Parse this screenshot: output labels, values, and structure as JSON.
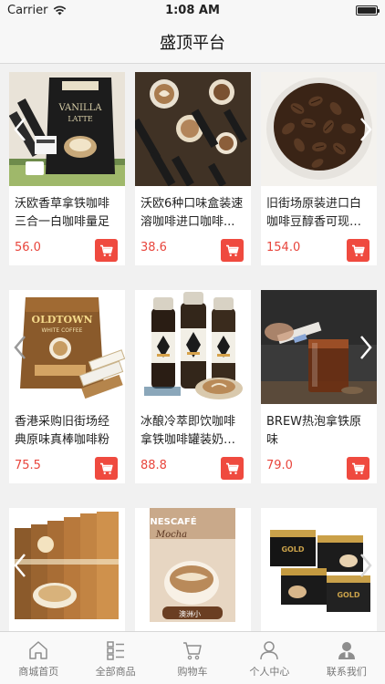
{
  "status_bar": {
    "carrier": "Carrier",
    "time": "1:08 AM",
    "battery_level": 1.0
  },
  "nav": {
    "title": "盛顶平台"
  },
  "products": [
    {
      "name": "沃欧香草拿铁咖啡三合一白咖啡量足",
      "price": "56.0",
      "image": "vanilla-latte-packaging",
      "arrows": [
        "left"
      ]
    },
    {
      "name": "沃欧6种口味盒装速溶咖啡进口咖啡...",
      "price": "38.6",
      "image": "coffee-cups-and-sticks",
      "arrows": []
    },
    {
      "name": "旧街场原装进口白咖啡豆醇香可现磨...",
      "price": "154.0",
      "image": "coffee-beans-bowl",
      "arrows": [
        "right"
      ]
    },
    {
      "name": "香港采购旧街场经典原味真棒咖啡粉",
      "price": "75.5",
      "image": "oldtown-white-coffee-bag",
      "arrows": [
        "left"
      ]
    },
    {
      "name": "冰酿冷萃即饮咖啡拿铁咖啡罐装奶咖...",
      "price": "88.8",
      "image": "cold-brew-bottles",
      "arrows": []
    },
    {
      "name": "BREW热泡拿铁原味",
      "price": "79.0",
      "image": "brew-iced-coffee-glass",
      "arrows": [
        "right"
      ]
    },
    {
      "name": "",
      "price": "",
      "image": "coffee-boxes-stack",
      "arrows": [
        "left"
      ]
    },
    {
      "name": "",
      "price": "",
      "image": "nescafe-mocha-box",
      "arrows": []
    },
    {
      "name": "",
      "price": "",
      "image": "nescafe-gold-boxes",
      "arrows": [
        "right"
      ]
    }
  ],
  "nescafe_labels": {
    "brand": "NESCAFÉ",
    "flavor": "Mocha",
    "sub": "澳洲小",
    "gold": "GOLD"
  },
  "oldtown_label": {
    "brand": "OLDTOWN",
    "sub": "WHITE COFFEE"
  },
  "vanilla_label": {
    "text": "VANILLA",
    "sub": "LATTE"
  },
  "tabs": [
    {
      "label": "商城首页",
      "icon": "home-icon"
    },
    {
      "label": "全部商品",
      "icon": "list-icon"
    },
    {
      "label": "购物车",
      "icon": "cart-icon"
    },
    {
      "label": "个人中心",
      "icon": "person-icon"
    },
    {
      "label": "联系我们",
      "icon": "contact-icon"
    }
  ],
  "colors": {
    "accent": "#ef4a3f",
    "price": "#e8453c",
    "tab_icon": "#8e8e8e"
  }
}
